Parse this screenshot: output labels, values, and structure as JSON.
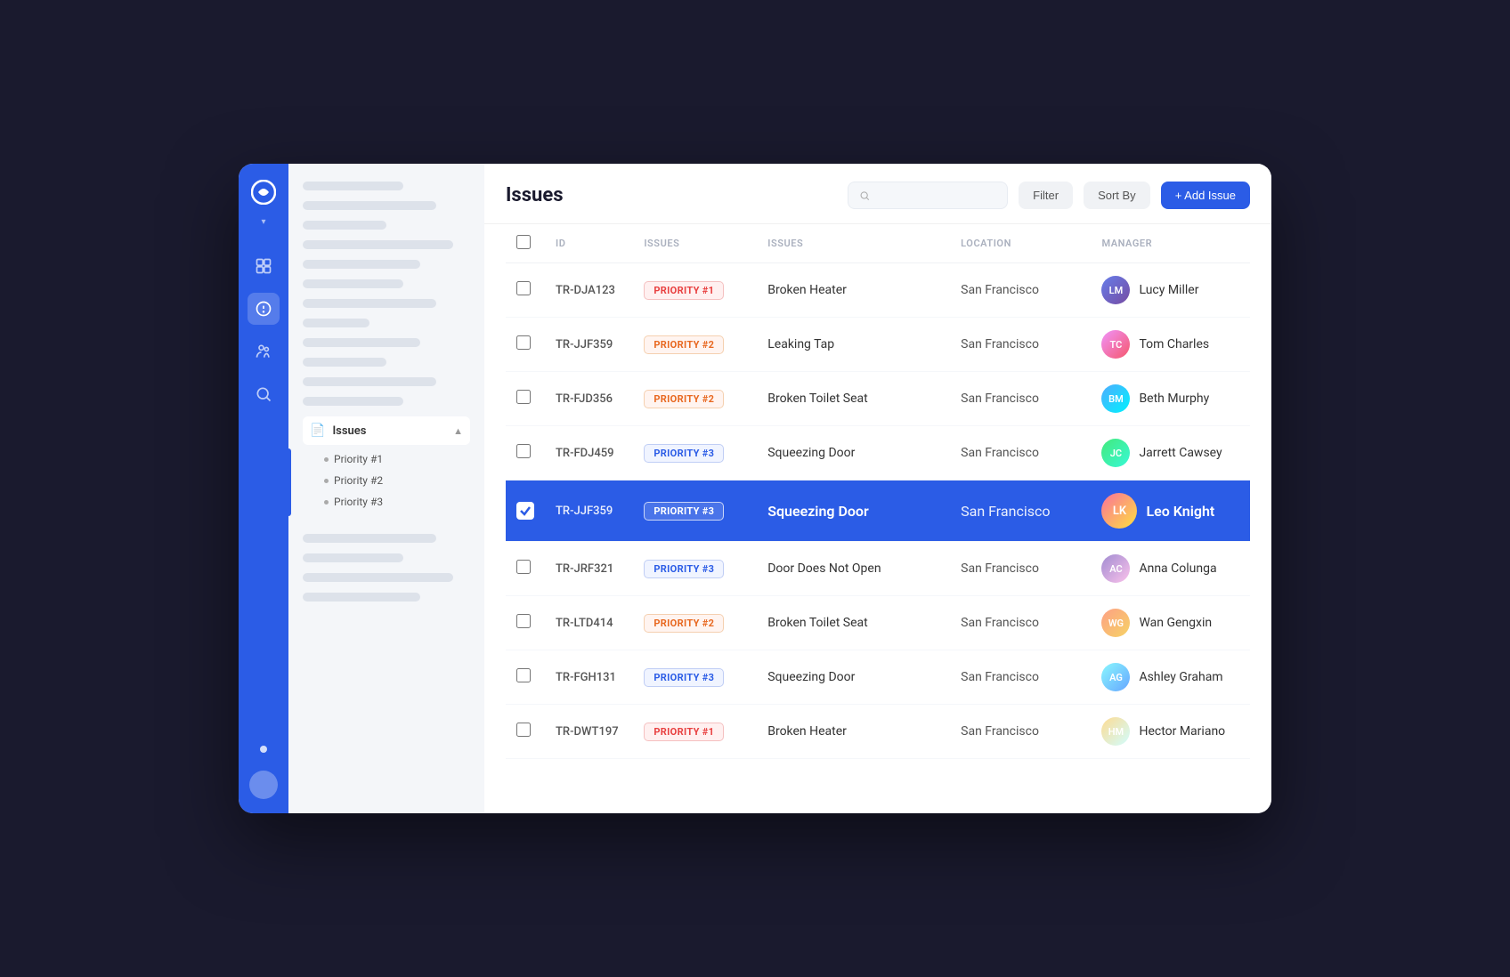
{
  "app": {
    "title": "Issues"
  },
  "header": {
    "title": "Issues",
    "search_placeholder": "",
    "btn_filter": "Filter",
    "btn_sort": "Sort By",
    "btn_add": "+ Add Issue"
  },
  "table": {
    "columns": [
      "",
      "ID",
      "ISSUES",
      "ISSUES",
      "LOCATION",
      "MANAGER"
    ],
    "rows": [
      {
        "id": "TR-DJA123",
        "priority": "PRIORITY #1",
        "priority_class": "p1",
        "issue": "Broken Heater",
        "location": "San Francisco",
        "manager": "Lucy Miller",
        "avatar_class": "av-lucy",
        "avatar_initials": "LM",
        "selected": false
      },
      {
        "id": "TR-JJF359",
        "priority": "PRIORITY #2",
        "priority_class": "p2",
        "issue": "Leaking Tap",
        "location": "San Francisco",
        "manager": "Tom Charles",
        "avatar_class": "av-tom",
        "avatar_initials": "TC",
        "selected": false
      },
      {
        "id": "TR-FJD356",
        "priority": "PRIORITY #2",
        "priority_class": "p2",
        "issue": "Broken Toilet Seat",
        "location": "San Francisco",
        "manager": "Beth Murphy",
        "avatar_class": "av-beth",
        "avatar_initials": "BM",
        "selected": false
      },
      {
        "id": "TR-FDJ459",
        "priority": "PRIORITY #3",
        "priority_class": "p3",
        "issue": "Squeezing Door",
        "location": "San Francisco",
        "manager": "Jarrett Cawsey",
        "avatar_class": "av-jarrett",
        "avatar_initials": "JC",
        "selected": false
      },
      {
        "id": "TR-JJF359",
        "priority": "PRIORITY #3",
        "priority_class": "p3-selected",
        "issue": "Squeezing Door",
        "location": "San Francisco",
        "manager": "Leo Knight",
        "avatar_class": "av-leo",
        "avatar_initials": "LK",
        "selected": true
      },
      {
        "id": "TR-JRF321",
        "priority": "PRIORITY #3",
        "priority_class": "p3",
        "issue": "Door Does Not Open",
        "location": "San Francisco",
        "manager": "Anna Colunga",
        "avatar_class": "av-anna",
        "avatar_initials": "AC",
        "selected": false
      },
      {
        "id": "TR-LTD414",
        "priority": "PRIORITY #2",
        "priority_class": "p2",
        "issue": "Broken Toilet Seat",
        "location": "San Francisco",
        "manager": "Wan Gengxin",
        "avatar_class": "av-wan",
        "avatar_initials": "WG",
        "selected": false
      },
      {
        "id": "TR-FGH131",
        "priority": "PRIORITY #3",
        "priority_class": "p3",
        "issue": "Squeezing Door",
        "location": "San Francisco",
        "manager": "Ashley Graham",
        "avatar_class": "av-ashley",
        "avatar_initials": "AG",
        "selected": false
      },
      {
        "id": "TR-DWT197",
        "priority": "PRIORITY #1",
        "priority_class": "p1",
        "issue": "Broken Heater",
        "location": "San Francisco",
        "manager": "Hector Mariano",
        "avatar_class": "av-hector",
        "avatar_initials": "HM",
        "selected": false
      }
    ]
  },
  "sidebar": {
    "section_label": "Issues",
    "sub_items": [
      "Priority #1",
      "Priority #2",
      "Priority #3"
    ]
  },
  "colors": {
    "accent": "#2b5ce6"
  }
}
